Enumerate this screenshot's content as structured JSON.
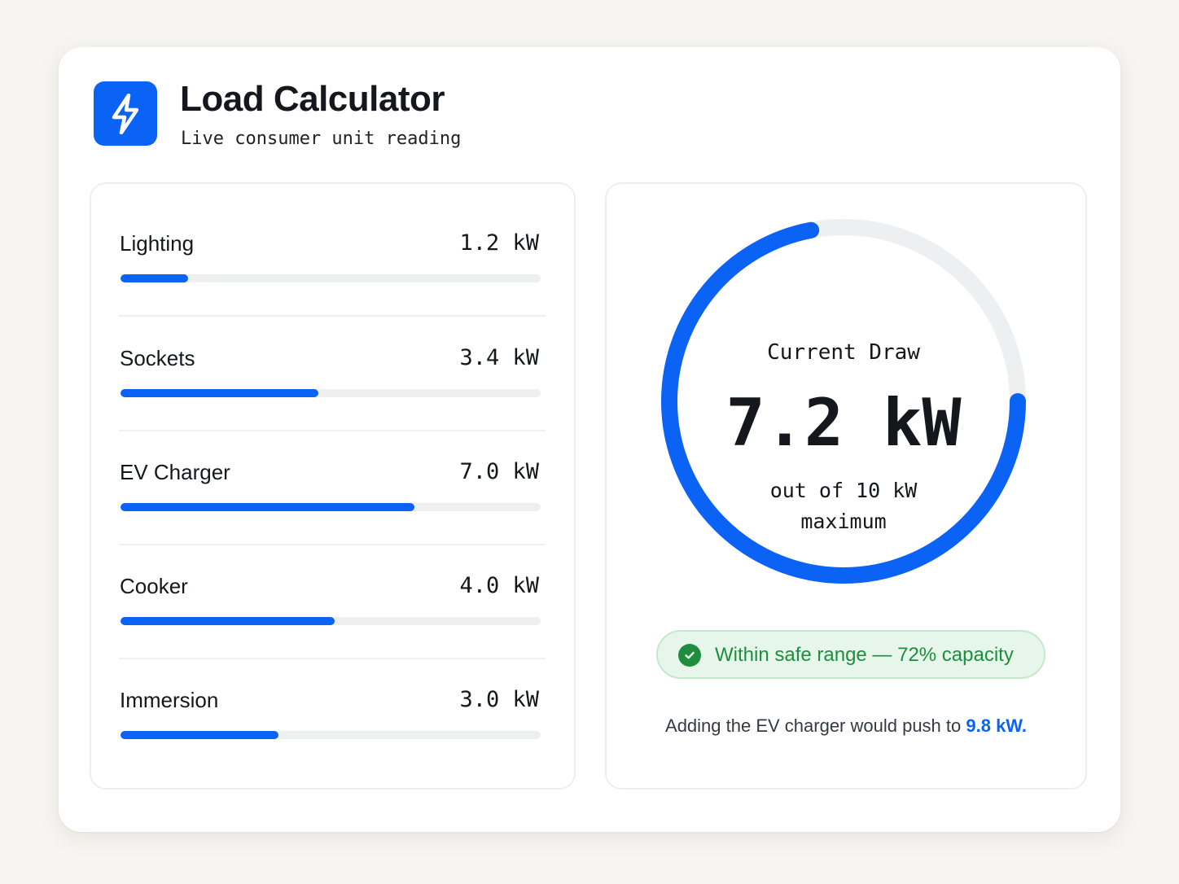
{
  "header": {
    "logo_icon": "lightning-bolt-icon",
    "title": "Load Calculator",
    "subtitle": "Live consumer unit reading"
  },
  "accent_color": "#0b63f6",
  "loads": [
    {
      "label": "Lighting",
      "value": "1.2 kW",
      "fill_fraction": 0.16
    },
    {
      "label": "Sockets",
      "value": "3.4 kW",
      "fill_fraction": 0.47
    },
    {
      "label": "EV Charger",
      "value": "7.0 kW",
      "fill_fraction": 0.7
    },
    {
      "label": "Cooker",
      "value": "4.0 kW",
      "fill_fraction": 0.51
    },
    {
      "label": "Immersion",
      "value": "3.0 kW",
      "fill_fraction": 0.375
    }
  ],
  "gauge": {
    "caption": "Current Draw",
    "value": "7.2 kW",
    "sub_line1": "out of 10 kW",
    "sub_line2": "maximum",
    "fraction": 0.72
  },
  "status": {
    "icon": "check-circle-icon",
    "text": "Within safe range — 72% capacity",
    "color": "#1e8e3e"
  },
  "note": {
    "prefix": "Adding the EV charger would push to ",
    "highlight": "9.8 kW."
  }
}
